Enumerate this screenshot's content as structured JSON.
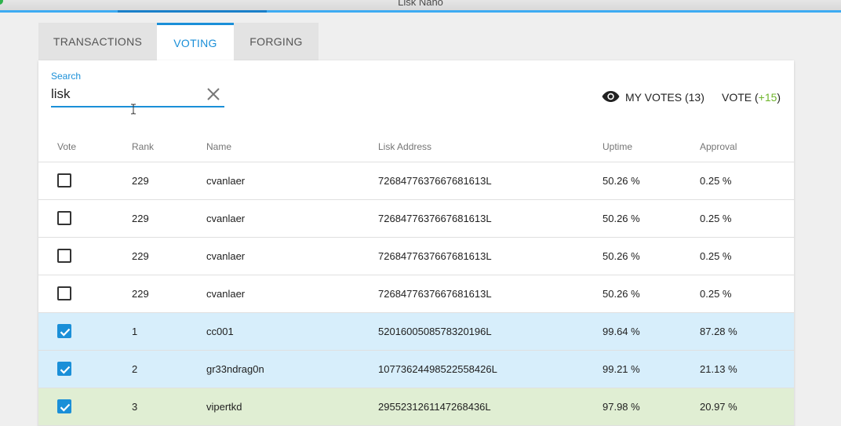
{
  "window": {
    "title": "Lisk Nano"
  },
  "tabs": [
    {
      "label": "TRANSACTIONS"
    },
    {
      "label": "VOTING"
    },
    {
      "label": "FORGING"
    }
  ],
  "search": {
    "label": "Search",
    "value": "lisk"
  },
  "actions": {
    "my_votes": "MY VOTES (13)",
    "vote_prefix": "VOTE (",
    "vote_delta": "+15",
    "vote_suffix": ")"
  },
  "columns": {
    "vote": "Vote",
    "rank": "Rank",
    "name": "Name",
    "address": "Lisk Address",
    "uptime": "Uptime",
    "approval": "Approval"
  },
  "rows": [
    {
      "checked": false,
      "state": "default",
      "rank": "229",
      "name": "cvanlaer",
      "address": "7268477637667681613L",
      "uptime": "50.26 %",
      "approval": "0.25 %"
    },
    {
      "checked": false,
      "state": "default",
      "rank": "229",
      "name": "cvanlaer",
      "address": "7268477637667681613L",
      "uptime": "50.26 %",
      "approval": "0.25 %"
    },
    {
      "checked": false,
      "state": "default",
      "rank": "229",
      "name": "cvanlaer",
      "address": "7268477637667681613L",
      "uptime": "50.26 %",
      "approval": "0.25 %"
    },
    {
      "checked": false,
      "state": "default",
      "rank": "229",
      "name": "cvanlaer",
      "address": "7268477637667681613L",
      "uptime": "50.26 %",
      "approval": "0.25 %"
    },
    {
      "checked": true,
      "state": "voted",
      "rank": "1",
      "name": "cc001",
      "address": "5201600508578320196L",
      "uptime": "99.64 %",
      "approval": "87.28 %"
    },
    {
      "checked": true,
      "state": "voted",
      "rank": "2",
      "name": "gr33ndrag0n",
      "address": "10773624498522558426L",
      "uptime": "99.21 %",
      "approval": "21.13 %"
    },
    {
      "checked": true,
      "state": "newvote",
      "rank": "3",
      "name": "vipertkd",
      "address": "2955231261147268436L",
      "uptime": "97.98 %",
      "approval": "20.97 %"
    }
  ],
  "colors": {
    "accent": "#1a8fd8",
    "voted_row": "#d7eefb",
    "new_vote_row": "#e0eed3",
    "positive": "#6fb52c"
  }
}
